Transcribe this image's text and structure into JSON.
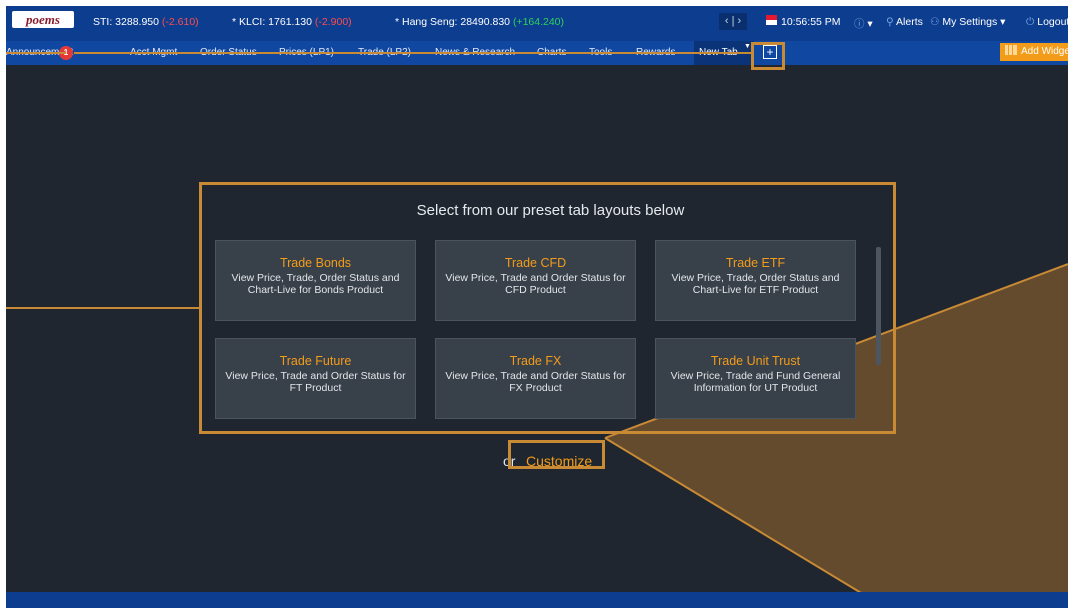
{
  "header": {
    "logo": "poems",
    "indices": [
      {
        "name": "STI: 3288.950",
        "change": "(-2.610)"
      },
      {
        "name": "* KLCI: 1761.130",
        "change": "(-2.900)"
      },
      {
        "name": "* Hang Seng: 28490.830",
        "change": "(+164.240)"
      }
    ],
    "nav_arrows": "‹ | ›",
    "time": "10:56:55 PM",
    "alerts": "Alerts",
    "settings": "My Settings",
    "logout": "Logout"
  },
  "tabs": [
    {
      "label": "Announcement"
    },
    {
      "label": "Acct Mgmt"
    },
    {
      "label": "Order Status"
    },
    {
      "label": "Prices (LP1)"
    },
    {
      "label": "Trade (LP2)"
    },
    {
      "label": "News & Research"
    },
    {
      "label": "Charts"
    },
    {
      "label": "Tools"
    },
    {
      "label": "Rewards"
    },
    {
      "label": "New Tab"
    }
  ],
  "announcement_badge": "1",
  "add_tab": "+",
  "add_widget": "Add Widget",
  "presets": {
    "title": "Select from our preset tab layouts below",
    "cards": [
      {
        "title": "Trade Bonds",
        "desc": "View Price, Trade, Order Status and Chart-Live for Bonds Product"
      },
      {
        "title": "Trade CFD",
        "desc": "View Price, Trade and Order Status for CFD Product"
      },
      {
        "title": "Trade ETF",
        "desc": "View Price, Trade, Order Status and Chart-Live for ETF Product"
      },
      {
        "title": "Trade Future",
        "desc": "View Price, Trade and Order Status for FT Product"
      },
      {
        "title": "Trade FX",
        "desc": "View Price, Trade and Order Status for FX Product"
      },
      {
        "title": "Trade Unit Trust",
        "desc": "View Price, Trade and Fund General Information for UT Product"
      }
    ]
  },
  "or_text": "or",
  "customize": "Customize",
  "colors": {
    "accent": "#f39c1a",
    "header": "#0c3d8f",
    "background": "#1f262f",
    "highlight": "#c98a35"
  }
}
